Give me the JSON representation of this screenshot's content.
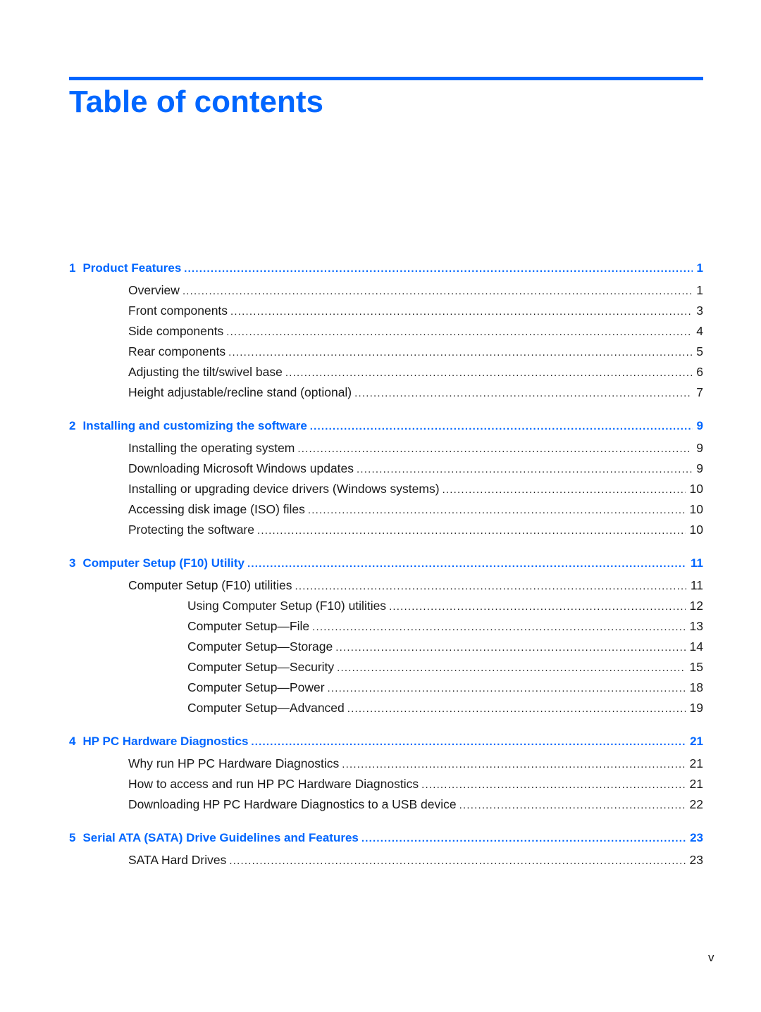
{
  "page": {
    "title": "Table of contents",
    "folio": "v",
    "accent_color": "#0066ff"
  },
  "toc": [
    {
      "number": "1",
      "title": "Product Features",
      "page": "1",
      "entries": [
        {
          "level": 1,
          "title": "Overview",
          "page": "1"
        },
        {
          "level": 1,
          "title": "Front components",
          "page": "3"
        },
        {
          "level": 1,
          "title": "Side components",
          "page": "4"
        },
        {
          "level": 1,
          "title": "Rear components",
          "page": "5"
        },
        {
          "level": 1,
          "title": "Adjusting the tilt/swivel base",
          "page": "6"
        },
        {
          "level": 1,
          "title": "Height adjustable/recline stand (optional)",
          "page": "7"
        }
      ]
    },
    {
      "number": "2",
      "title": "Installing and customizing the software",
      "page": "9",
      "entries": [
        {
          "level": 1,
          "title": "Installing the operating system",
          "page": "9"
        },
        {
          "level": 1,
          "title": "Downloading Microsoft Windows updates",
          "page": "9"
        },
        {
          "level": 1,
          "title": "Installing or upgrading device drivers (Windows systems)",
          "page": "10"
        },
        {
          "level": 1,
          "title": "Accessing disk image (ISO) files",
          "page": "10"
        },
        {
          "level": 1,
          "title": "Protecting the software",
          "page": "10"
        }
      ]
    },
    {
      "number": "3",
      "title": "Computer Setup (F10) Utility",
      "page": "11",
      "entries": [
        {
          "level": 1,
          "title": "Computer Setup (F10) utilities",
          "page": "11"
        },
        {
          "level": 2,
          "title": "Using Computer Setup (F10) utilities",
          "page": "12"
        },
        {
          "level": 2,
          "title": "Computer Setup—File",
          "page": "13"
        },
        {
          "level": 2,
          "title": "Computer Setup—Storage",
          "page": "14"
        },
        {
          "level": 2,
          "title": "Computer Setup—Security",
          "page": "15"
        },
        {
          "level": 2,
          "title": "Computer Setup—Power",
          "page": "18"
        },
        {
          "level": 2,
          "title": "Computer Setup—Advanced",
          "page": "19"
        }
      ]
    },
    {
      "number": "4",
      "title": "HP PC Hardware Diagnostics",
      "page": "21",
      "entries": [
        {
          "level": 1,
          "title": "Why run HP PC Hardware Diagnostics",
          "page": "21"
        },
        {
          "level": 1,
          "title": "How to access and run HP PC Hardware Diagnostics",
          "page": "21"
        },
        {
          "level": 1,
          "title": "Downloading HP PC Hardware Diagnostics to a USB device",
          "page": "22"
        }
      ]
    },
    {
      "number": "5",
      "title": "Serial ATA (SATA) Drive Guidelines and Features",
      "page": "23",
      "entries": [
        {
          "level": 1,
          "title": "SATA Hard Drives",
          "page": "23"
        }
      ]
    }
  ]
}
